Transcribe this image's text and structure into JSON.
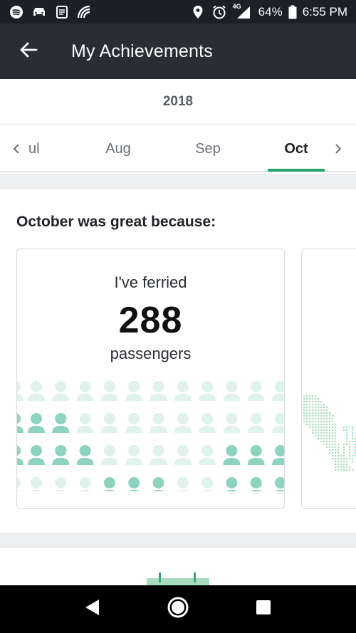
{
  "status_bar": {
    "battery": "64%",
    "time": "6:55 PM",
    "network": "4G",
    "icons": [
      "spotify-icon",
      "car-icon",
      "clipboard-icon",
      "signal-app-icon",
      "location-icon",
      "alarm-icon",
      "cell-signal-icon",
      "battery-icon"
    ]
  },
  "app_bar": {
    "title": "My Achievements",
    "back_icon": "arrow-left-icon"
  },
  "year": "2018",
  "months": {
    "prev_partial": "ul",
    "items": [
      "Aug",
      "Sep",
      "Oct"
    ],
    "selected": "Oct"
  },
  "section": {
    "title": "October was great because:"
  },
  "card": {
    "pre": "I've ferried",
    "number": "288",
    "post": "passengers"
  },
  "colors": {
    "accent": "#22a56a",
    "person_dark": "#8dd3bf",
    "person_light": "#dff2ec",
    "status_bar": "#1c1f26",
    "app_bar": "#2a2d34"
  }
}
